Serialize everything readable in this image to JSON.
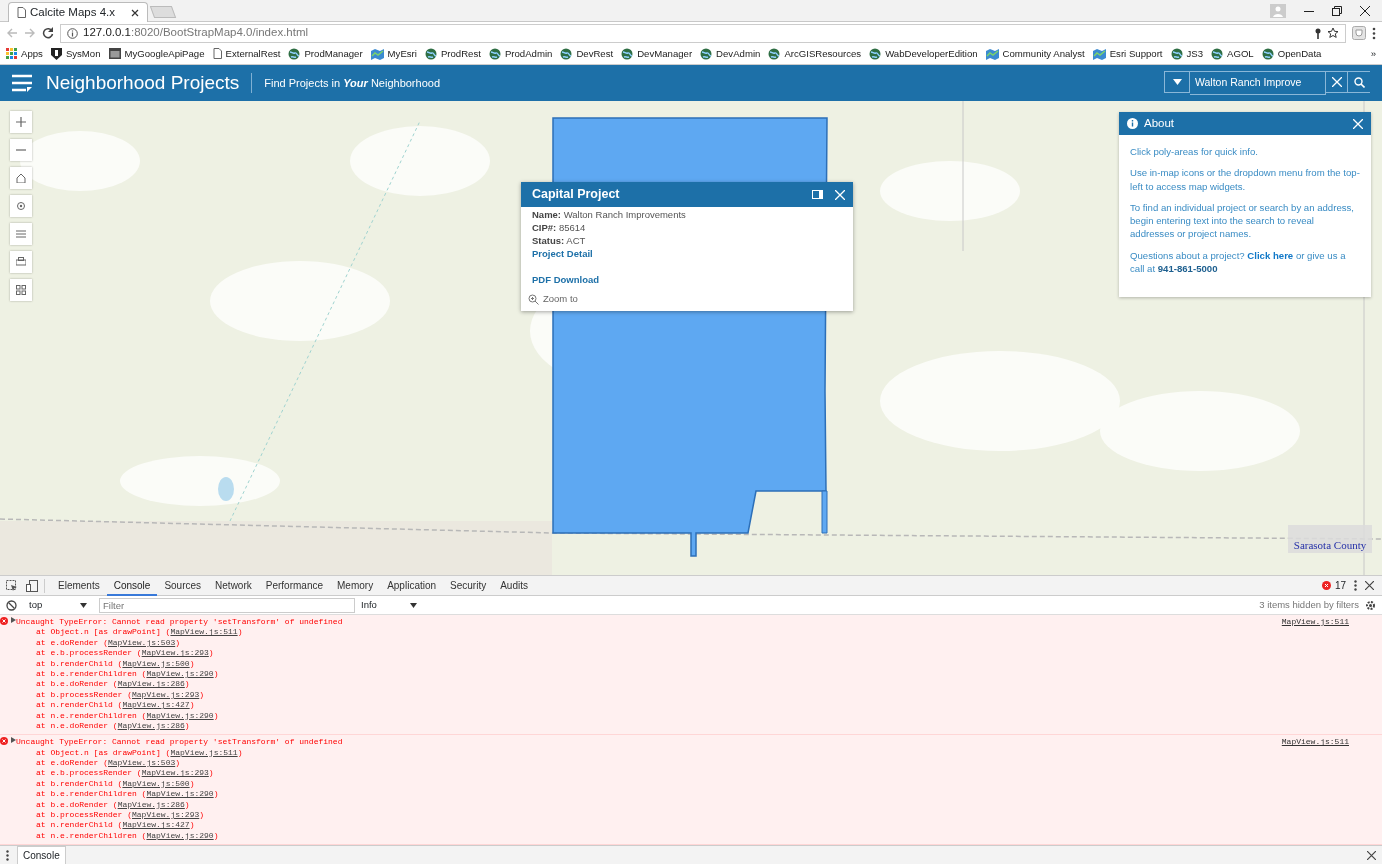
{
  "browser": {
    "tab_title": "Calcite Maps 4.x",
    "address_host": "127.0.0.1",
    "address_path": ":8020/BootStrapMap4.0/index.html",
    "bookmarks": [
      {
        "label": "Apps",
        "kind": "apps"
      },
      {
        "label": "SysMon",
        "kind": "shield"
      },
      {
        "label": "MyGoogleApiPage",
        "kind": "window"
      },
      {
        "label": "ExternalRest",
        "kind": "page"
      },
      {
        "label": "ProdManager",
        "kind": "globe"
      },
      {
        "label": "MyEsri",
        "kind": "map"
      },
      {
        "label": "ProdRest",
        "kind": "globe"
      },
      {
        "label": "ProdAdmin",
        "kind": "globe"
      },
      {
        "label": "DevRest",
        "kind": "globe"
      },
      {
        "label": "DevManager",
        "kind": "globe"
      },
      {
        "label": "DevAdmin",
        "kind": "globe"
      },
      {
        "label": "ArcGISResources",
        "kind": "globe"
      },
      {
        "label": "WabDeveloperEdition",
        "kind": "globe"
      },
      {
        "label": "Community Analyst",
        "kind": "map"
      },
      {
        "label": "Esri Support",
        "kind": "map"
      },
      {
        "label": "JS3",
        "kind": "globe"
      },
      {
        "label": "AGOL",
        "kind": "globe"
      },
      {
        "label": "OpenData",
        "kind": "globe"
      }
    ],
    "more": "»"
  },
  "app": {
    "title": "Neighborhood Projects",
    "subtitle": "Find Projects in **Your** Neighborhood",
    "search_value": "Walton Ranch Improve"
  },
  "map": {
    "logo": "Sarasota County"
  },
  "popup": {
    "title": "Capital Project",
    "fields": [
      {
        "label": "Name:",
        "value": "Walton Ranch Improvements"
      },
      {
        "label": "CIP#:",
        "value": "85614"
      },
      {
        "label": "Status:",
        "value": "ACT"
      }
    ],
    "links": [
      "Project Detail",
      "PDF Download"
    ],
    "zoom_to": "Zoom to"
  },
  "about": {
    "title": "About",
    "paragraphs": [
      "Click poly-areas for quick info.",
      "Use in-map icons or the dropdown menu from the top-left to access map widgets.",
      "To find an individual project or search by an address, begin entering text into the search to reveal addresses or project names."
    ],
    "contact": {
      "before": "Questions about a project?",
      "link": "Click here",
      "after": "or give us a call at",
      "phone": "941-861-5000"
    }
  },
  "devtools": {
    "tabs": [
      {
        "label": "Elements",
        "selected": false
      },
      {
        "label": "Console",
        "selected": true
      },
      {
        "label": "Sources",
        "selected": false
      },
      {
        "label": "Network",
        "selected": false
      },
      {
        "label": "Performance",
        "selected": false
      },
      {
        "label": "Memory",
        "selected": false
      },
      {
        "label": "Application",
        "selected": false
      },
      {
        "label": "Security",
        "selected": false
      },
      {
        "label": "Audits",
        "selected": false
      }
    ],
    "error_count": "17",
    "context": "top",
    "filter_placeholder": "Filter",
    "level": "Info",
    "hidden_note": "3 items hidden by filters",
    "messages": [
      {
        "message": "Uncaught TypeError: Cannot read property 'setTransform' of undefined",
        "source": "MapView.js:511",
        "stack": [
          {
            "text": "at Object.n [as drawPoint] (",
            "link": "MapView.js:511",
            "end": ")"
          },
          {
            "text": "at e.doRender (",
            "link": "MapView.js:503",
            "end": ")"
          },
          {
            "text": "at e.b.processRender (",
            "link": "MapView.js:293",
            "end": ")"
          },
          {
            "text": "at b.renderChild (",
            "link": "MapView.js:500",
            "end": ")"
          },
          {
            "text": "at b.e.renderChildren (",
            "link": "MapView.js:290",
            "end": ")"
          },
          {
            "text": "at b.e.doRender (",
            "link": "MapView.js:286",
            "end": ")"
          },
          {
            "text": "at b.processRender (",
            "link": "MapView.js:293",
            "end": ")"
          },
          {
            "text": "at n.renderChild (",
            "link": "MapView.js:427",
            "end": ")"
          },
          {
            "text": "at n.e.renderChildren (",
            "link": "MapView.js:290",
            "end": ")"
          },
          {
            "text": "at n.e.doRender (",
            "link": "MapView.js:286",
            "end": ")"
          }
        ]
      },
      {
        "message": "Uncaught TypeError: Cannot read property 'setTransform' of undefined",
        "source": "MapView.js:511",
        "stack": [
          {
            "text": "at Object.n [as drawPoint] (",
            "link": "MapView.js:511",
            "end": ")"
          },
          {
            "text": "at e.doRender (",
            "link": "MapView.js:503",
            "end": ")"
          },
          {
            "text": "at e.b.processRender (",
            "link": "MapView.js:293",
            "end": ")"
          },
          {
            "text": "at b.renderChild (",
            "link": "MapView.js:500",
            "end": ")"
          },
          {
            "text": "at b.e.renderChildren (",
            "link": "MapView.js:290",
            "end": ")"
          },
          {
            "text": "at b.e.doRender (",
            "link": "MapView.js:286",
            "end": ")"
          },
          {
            "text": "at b.processRender (",
            "link": "MapView.js:293",
            "end": ")"
          },
          {
            "text": "at n.renderChild (",
            "link": "MapView.js:427",
            "end": ")"
          },
          {
            "text": "at n.e.renderChildren (",
            "link": "MapView.js:290",
            "end": ")"
          }
        ]
      }
    ],
    "drawer_tab": "Console"
  }
}
